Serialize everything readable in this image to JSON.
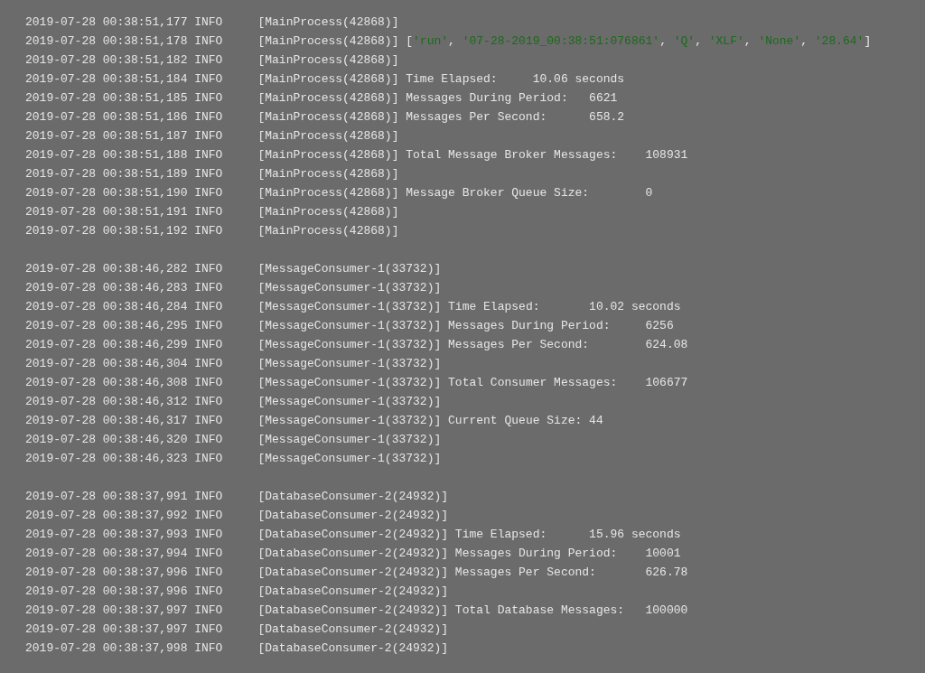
{
  "log_groups": [
    {
      "lines": [
        {
          "timestamp": "2019-07-28 00:38:51,177",
          "level": "INFO",
          "source": "[MainProcess(42868)]"
        },
        {
          "timestamp": "2019-07-28 00:38:51,178",
          "level": "INFO",
          "source": "[MainProcess(42868)]",
          "message": [
            {
              "kind": "plain",
              "text": "["
            },
            {
              "kind": "string",
              "text": "'run'"
            },
            {
              "kind": "plain",
              "text": ", "
            },
            {
              "kind": "string",
              "text": "'07-28-2019_00:38:51:076861'"
            },
            {
              "kind": "plain",
              "text": ", "
            },
            {
              "kind": "string",
              "text": "'Q'"
            },
            {
              "kind": "plain",
              "text": ", "
            },
            {
              "kind": "string",
              "text": "'XLF'"
            },
            {
              "kind": "plain",
              "text": ", "
            },
            {
              "kind": "string",
              "text": "'None'"
            },
            {
              "kind": "plain",
              "text": ", "
            },
            {
              "kind": "string",
              "text": "'28.64'"
            },
            {
              "kind": "plain",
              "text": "]"
            }
          ]
        },
        {
          "timestamp": "2019-07-28 00:38:51,182",
          "level": "INFO",
          "source": "[MainProcess(42868)]"
        },
        {
          "timestamp": "2019-07-28 00:38:51,184",
          "level": "INFO",
          "source": "[MainProcess(42868)]",
          "message": [
            {
              "kind": "plain",
              "text": "Time Elapsed:     10.06 seconds"
            }
          ]
        },
        {
          "timestamp": "2019-07-28 00:38:51,185",
          "level": "INFO",
          "source": "[MainProcess(42868)]",
          "message": [
            {
              "kind": "plain",
              "text": "Messages During Period:   6621"
            }
          ]
        },
        {
          "timestamp": "2019-07-28 00:38:51,186",
          "level": "INFO",
          "source": "[MainProcess(42868)]",
          "message": [
            {
              "kind": "plain",
              "text": "Messages Per Second:      658.2"
            }
          ]
        },
        {
          "timestamp": "2019-07-28 00:38:51,187",
          "level": "INFO",
          "source": "[MainProcess(42868)]"
        },
        {
          "timestamp": "2019-07-28 00:38:51,188",
          "level": "INFO",
          "source": "[MainProcess(42868)]",
          "message": [
            {
              "kind": "plain",
              "text": "Total Message Broker Messages:    108931"
            }
          ]
        },
        {
          "timestamp": "2019-07-28 00:38:51,189",
          "level": "INFO",
          "source": "[MainProcess(42868)]"
        },
        {
          "timestamp": "2019-07-28 00:38:51,190",
          "level": "INFO",
          "source": "[MainProcess(42868)]",
          "message": [
            {
              "kind": "plain",
              "text": "Message Broker Queue Size:        0"
            }
          ]
        },
        {
          "timestamp": "2019-07-28 00:38:51,191",
          "level": "INFO",
          "source": "[MainProcess(42868)]"
        },
        {
          "timestamp": "2019-07-28 00:38:51,192",
          "level": "INFO",
          "source": "[MainProcess(42868)]"
        }
      ]
    },
    {
      "lines": [
        {
          "timestamp": "2019-07-28 00:38:46,282",
          "level": "INFO",
          "source": "[MessageConsumer-1(33732)]"
        },
        {
          "timestamp": "2019-07-28 00:38:46,283",
          "level": "INFO",
          "source": "[MessageConsumer-1(33732)]"
        },
        {
          "timestamp": "2019-07-28 00:38:46,284",
          "level": "INFO",
          "source": "[MessageConsumer-1(33732)]",
          "message": [
            {
              "kind": "plain",
              "text": "Time Elapsed:       10.02 seconds"
            }
          ]
        },
        {
          "timestamp": "2019-07-28 00:38:46,295",
          "level": "INFO",
          "source": "[MessageConsumer-1(33732)]",
          "message": [
            {
              "kind": "plain",
              "text": "Messages During Period:     6256"
            }
          ]
        },
        {
          "timestamp": "2019-07-28 00:38:46,299",
          "level": "INFO",
          "source": "[MessageConsumer-1(33732)]",
          "message": [
            {
              "kind": "plain",
              "text": "Messages Per Second:        624.08"
            }
          ]
        },
        {
          "timestamp": "2019-07-28 00:38:46,304",
          "level": "INFO",
          "source": "[MessageConsumer-1(33732)]"
        },
        {
          "timestamp": "2019-07-28 00:38:46,308",
          "level": "INFO",
          "source": "[MessageConsumer-1(33732)]",
          "message": [
            {
              "kind": "plain",
              "text": "Total Consumer Messages:    106677"
            }
          ]
        },
        {
          "timestamp": "2019-07-28 00:38:46,312",
          "level": "INFO",
          "source": "[MessageConsumer-1(33732)]"
        },
        {
          "timestamp": "2019-07-28 00:38:46,317",
          "level": "INFO",
          "source": "[MessageConsumer-1(33732)]",
          "message": [
            {
              "kind": "plain",
              "text": "Current Queue Size: 44"
            }
          ]
        },
        {
          "timestamp": "2019-07-28 00:38:46,320",
          "level": "INFO",
          "source": "[MessageConsumer-1(33732)]"
        },
        {
          "timestamp": "2019-07-28 00:38:46,323",
          "level": "INFO",
          "source": "[MessageConsumer-1(33732)]"
        }
      ]
    },
    {
      "lines": [
        {
          "timestamp": "2019-07-28 00:38:37,991",
          "level": "INFO",
          "source": "[DatabaseConsumer-2(24932)]"
        },
        {
          "timestamp": "2019-07-28 00:38:37,992",
          "level": "INFO",
          "source": "[DatabaseConsumer-2(24932)]"
        },
        {
          "timestamp": "2019-07-28 00:38:37,993",
          "level": "INFO",
          "source": "[DatabaseConsumer-2(24932)]",
          "message": [
            {
              "kind": "plain",
              "text": "Time Elapsed:      15.96 seconds"
            }
          ]
        },
        {
          "timestamp": "2019-07-28 00:38:37,994",
          "level": "INFO",
          "source": "[DatabaseConsumer-2(24932)]",
          "message": [
            {
              "kind": "plain",
              "text": "Messages During Period:    10001"
            }
          ]
        },
        {
          "timestamp": "2019-07-28 00:38:37,996",
          "level": "INFO",
          "source": "[DatabaseConsumer-2(24932)]",
          "message": [
            {
              "kind": "plain",
              "text": "Messages Per Second:       626.78"
            }
          ]
        },
        {
          "timestamp": "2019-07-28 00:38:37,996",
          "level": "INFO",
          "source": "[DatabaseConsumer-2(24932)]"
        },
        {
          "timestamp": "2019-07-28 00:38:37,997",
          "level": "INFO",
          "source": "[DatabaseConsumer-2(24932)]",
          "message": [
            {
              "kind": "plain",
              "text": "Total Database Messages:   100000"
            }
          ]
        },
        {
          "timestamp": "2019-07-28 00:38:37,997",
          "level": "INFO",
          "source": "[DatabaseConsumer-2(24932)]"
        },
        {
          "timestamp": "2019-07-28 00:38:37,998",
          "level": "INFO",
          "source": "[DatabaseConsumer-2(24932)]"
        }
      ]
    }
  ]
}
